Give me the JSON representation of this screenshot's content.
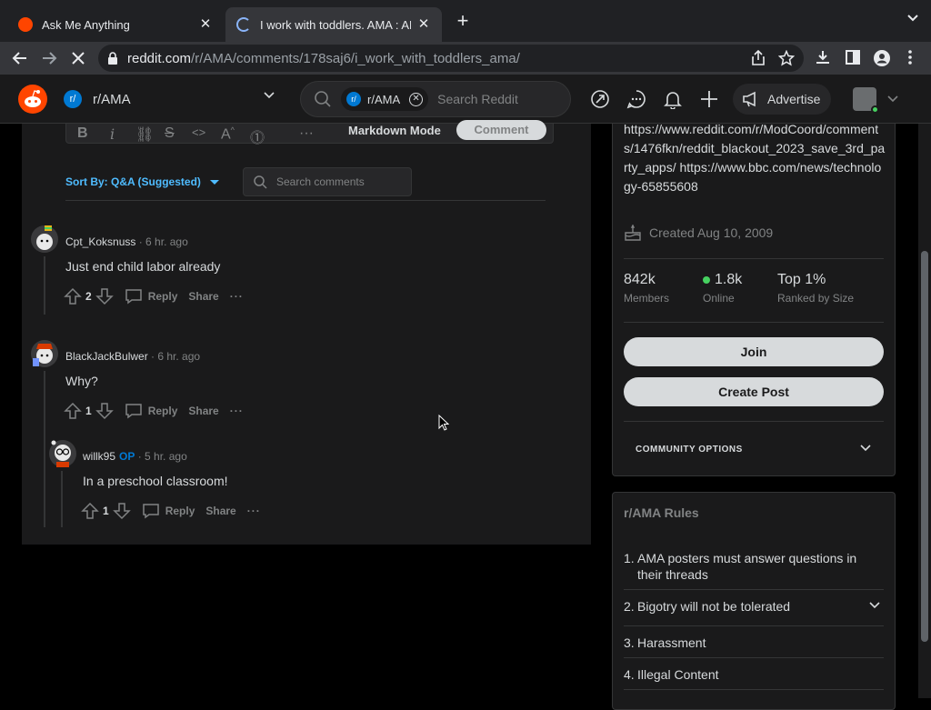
{
  "browser": {
    "tabs": [
      {
        "title": "Ask Me Anything",
        "active": false
      },
      {
        "title": "I work with toddlers. AMA : AMA",
        "active": true
      }
    ],
    "url_host": "reddit.com",
    "url_path": "/r/AMA/comments/178saj6/i_work_with_toddlers_ama/"
  },
  "header": {
    "community": "r/AMA",
    "search_chip": "r/AMA",
    "search_placeholder": "Search Reddit",
    "advertise": "Advertise"
  },
  "editor": {
    "markdown_mode": "Markdown Mode",
    "comment_button": "Comment"
  },
  "comments_toolbar": {
    "sort_label": "Sort By: Q&A (Suggested)",
    "search_placeholder": "Search comments"
  },
  "comments": [
    {
      "user": "Cpt_Koksnuss",
      "op": "",
      "time": "· 6 hr. ago",
      "body": "Just end child labor already",
      "votes": "2",
      "reply": "Reply",
      "share": "Share",
      "more": "···"
    },
    {
      "user": "BlackJackBulwer",
      "op": "",
      "time": "· 6 hr. ago",
      "body": "Why?",
      "votes": "1",
      "reply": "Reply",
      "share": "Share",
      "more": "···"
    },
    {
      "user": "willk95",
      "op": "OP",
      "time": "· 5 hr. ago",
      "body": "In a preschool classroom!",
      "votes": "1",
      "reply": "Reply",
      "share": "Share",
      "more": "···"
    }
  ],
  "sidebar": {
    "links_text": "https://www.reddit.com/r/ModCoord/comments/1476fkn/reddit_blackout_2023_save_3rd_party_apps/ https://www.bbc.com/news/technology-65855608",
    "created": "Created Aug 10, 2009",
    "stats": [
      {
        "value": "842k",
        "label": "Members"
      },
      {
        "value": "1.8k",
        "label": "Online"
      },
      {
        "value": "Top 1%",
        "label": "Ranked by Size"
      }
    ],
    "join": "Join",
    "create_post": "Create Post",
    "community_options": "COMMUNITY OPTIONS"
  },
  "rules": {
    "title": "r/AMA Rules",
    "items": [
      {
        "num": "1.",
        "text": "AMA posters must answer questions in their threads"
      },
      {
        "num": "2.",
        "text": "Bigotry will not be tolerated"
      },
      {
        "num": "3.",
        "text": "Harassment"
      },
      {
        "num": "4.",
        "text": "Illegal Content"
      }
    ]
  },
  "colors": {
    "reddit_orange": "#ff4500",
    "link_blue": "#4fbcff",
    "online_green": "#46d160"
  }
}
